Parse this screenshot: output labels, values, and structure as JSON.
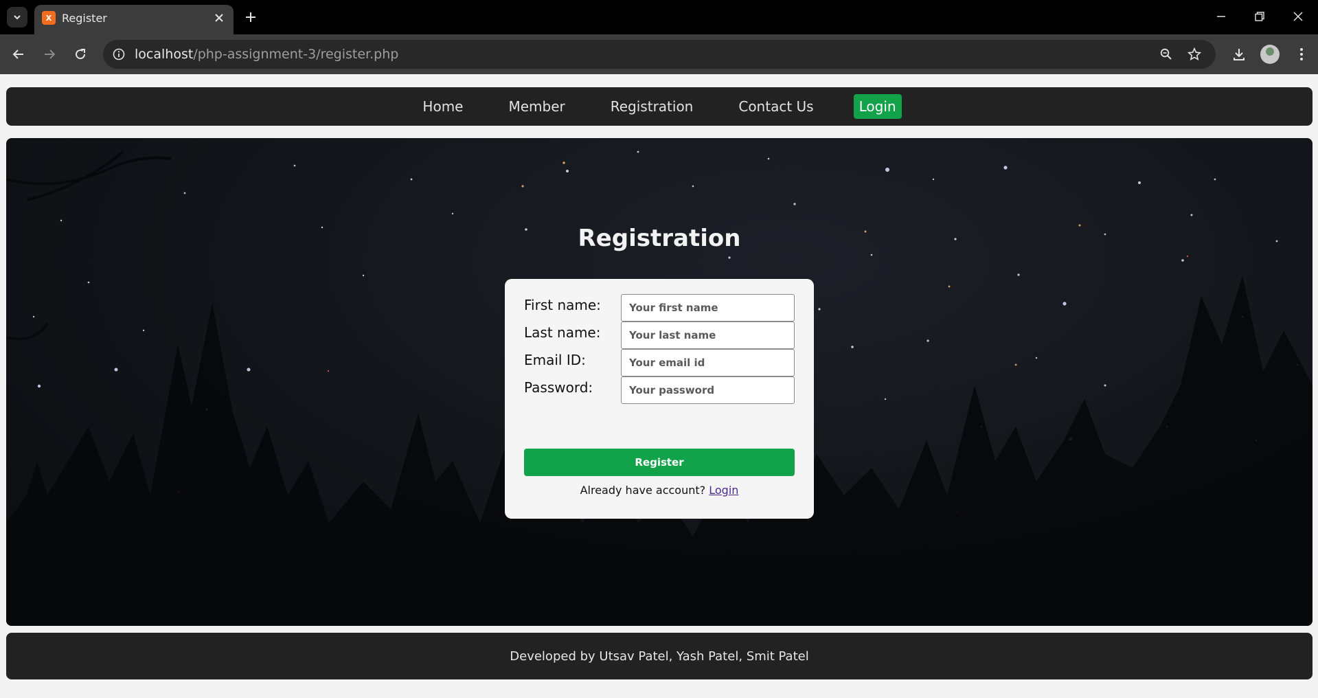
{
  "browser": {
    "tab_title": "Register",
    "favicon_text": "X",
    "url_host": "localhost",
    "url_path": "/php-assignment-3/register.php",
    "icons": [
      "tab-list-icon",
      "close-icon",
      "plus-icon",
      "back-icon",
      "forward-icon",
      "reload-icon",
      "info-icon",
      "zoom-icon",
      "star-icon",
      "download-icon",
      "avatar",
      "more-icon",
      "minimize-icon",
      "restore-icon",
      "window-close-icon"
    ]
  },
  "nav": {
    "items": [
      "Home",
      "Member",
      "Registration",
      "Contact Us",
      "Login"
    ]
  },
  "form": {
    "heading": "Registration",
    "fields": [
      {
        "label": "First name:",
        "placeholder": "Your first name"
      },
      {
        "label": "Last name:",
        "placeholder": "Your last name"
      },
      {
        "label": "Email ID:",
        "placeholder": "Your email id"
      },
      {
        "label": "Password:",
        "placeholder": "Your password"
      }
    ],
    "submit_label": "Register",
    "already_text": "Already have account?",
    "login_link": "Login"
  },
  "footer": {
    "text": "Developed by Utsav Patel, Yash Patel, Smit Patel"
  },
  "colors": {
    "accent_green": "#12a24a",
    "nav_bg": "#222222",
    "browser_toolbar": "#3c3c3c"
  }
}
